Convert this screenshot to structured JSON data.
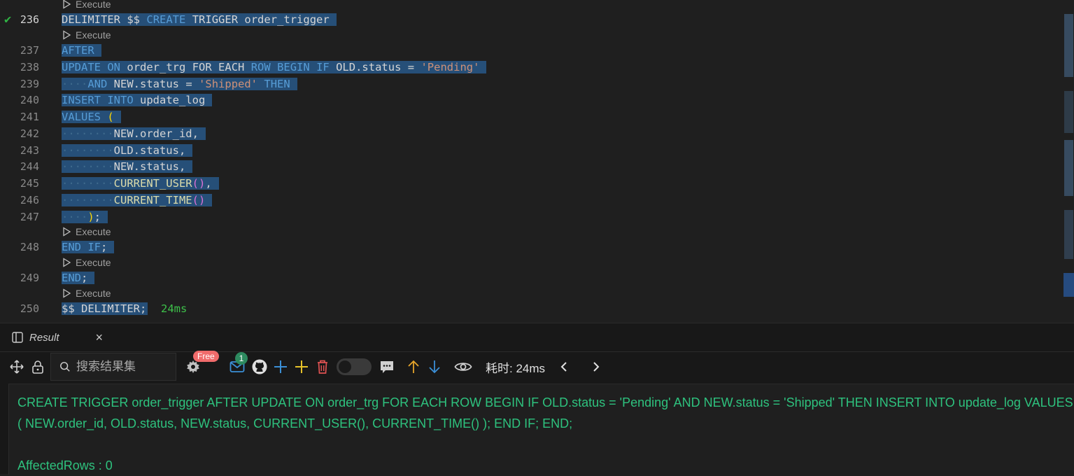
{
  "editor": {
    "codelens_label": "Execute",
    "lines": [
      {
        "num": "236",
        "status": "✔"
      },
      {
        "num": "237"
      },
      {
        "num": "238"
      },
      {
        "num": "239"
      },
      {
        "num": "240"
      },
      {
        "num": "241"
      },
      {
        "num": "242"
      },
      {
        "num": "243"
      },
      {
        "num": "244"
      },
      {
        "num": "245"
      },
      {
        "num": "246"
      },
      {
        "num": "247"
      },
      {
        "num": "248"
      },
      {
        "num": "249"
      },
      {
        "num": "250",
        "exec_time": "24ms"
      }
    ],
    "code": {
      "l236": [
        "DELIMITER",
        "$$",
        "CREATE",
        "TRIGGER",
        "order_trigger"
      ],
      "l237": [
        "AFTER"
      ],
      "l238": [
        "UPDATE",
        "ON",
        "order_trg",
        "FOR",
        "EACH",
        "ROW",
        "BEGIN",
        "IF",
        "OLD.status",
        "=",
        "'Pending'"
      ],
      "l239": [
        "AND",
        "NEW.status",
        "=",
        "'Shipped'",
        "THEN"
      ],
      "l240": [
        "INSERT",
        "INTO",
        "update_log"
      ],
      "l241": [
        "VALUES",
        "("
      ],
      "l242": [
        "NEW.order_id,"
      ],
      "l243": [
        "OLD.status,"
      ],
      "l244": [
        "NEW.status,"
      ],
      "l245": [
        "CURRENT_USER",
        "()",
        ","
      ],
      "l246": [
        "CURRENT_TIME",
        "()"
      ],
      "l247": [
        ")",
        ";"
      ],
      "l248": [
        "END",
        "IF",
        ";"
      ],
      "l249": [
        "END",
        ";"
      ],
      "l250": [
        "$$",
        "DELIMITER;"
      ]
    }
  },
  "panel": {
    "tab_label": "Result",
    "close_label": "×",
    "search_placeholder": "搜索结果集",
    "free_badge": "Free",
    "mail_count": "1",
    "elapsed": "耗时: 24ms",
    "output": {
      "sql": "CREATE TRIGGER order_trigger AFTER UPDATE ON order_trg FOR EACH ROW BEGIN IF OLD.status = 'Pending' AND NEW.status = 'Shipped' THEN INSERT INTO update_log VALUES ( NEW.order_id, OLD.status, NEW.status, CURRENT_USER(), CURRENT_TIME() ); END IF; END;",
      "affected": "AffectedRows : 0"
    }
  },
  "colors": {
    "selection": "#264f78",
    "keyword": "#569cd6",
    "string": "#ce9178",
    "function": "#dcdcaa",
    "success": "#2ec27e",
    "free_badge": "#f06b6b"
  }
}
